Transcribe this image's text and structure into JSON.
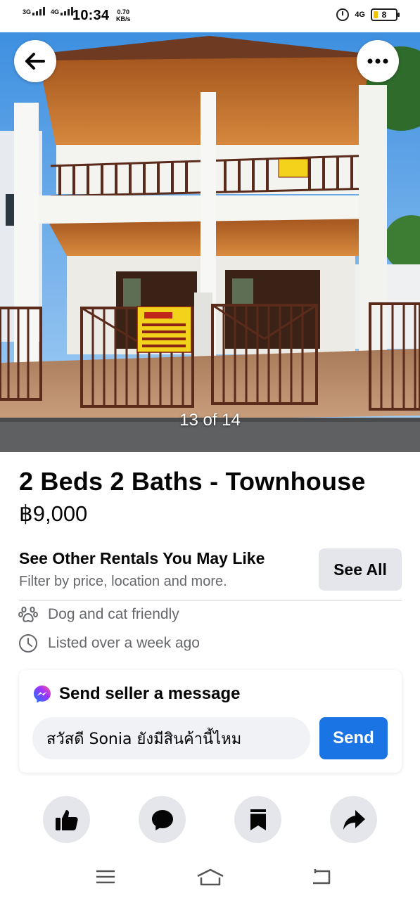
{
  "status_bar": {
    "net1": "3G",
    "net2": "4G",
    "time": "10:34",
    "speed_value": "0.70",
    "speed_unit": "KB/s",
    "signal_right": "4G",
    "battery": "8"
  },
  "photo": {
    "counter": "13 of 14"
  },
  "listing": {
    "title": "2 Beds 2 Baths - Townhouse",
    "price": "฿9,000"
  },
  "other_rentals": {
    "heading": "See Other Rentals You May Like",
    "subtitle": "Filter by price, location and more.",
    "see_all_label": "See All"
  },
  "features": [
    {
      "icon": "paw-icon",
      "text": "Dog and cat friendly"
    },
    {
      "icon": "clock-icon",
      "text": "Listed over a week ago"
    }
  ],
  "message": {
    "heading": "Send seller a message",
    "input_value": "สวัสดี Sonia ยังมีสินค้านี้ไหม",
    "send_label": "Send"
  },
  "actions": [
    {
      "icon": "like-icon"
    },
    {
      "icon": "comment-icon"
    },
    {
      "icon": "save-icon"
    },
    {
      "icon": "share-icon"
    }
  ],
  "colors": {
    "accent": "#1b74e4",
    "secondary_text": "#65676b",
    "button_gray": "#e4e6eb"
  }
}
